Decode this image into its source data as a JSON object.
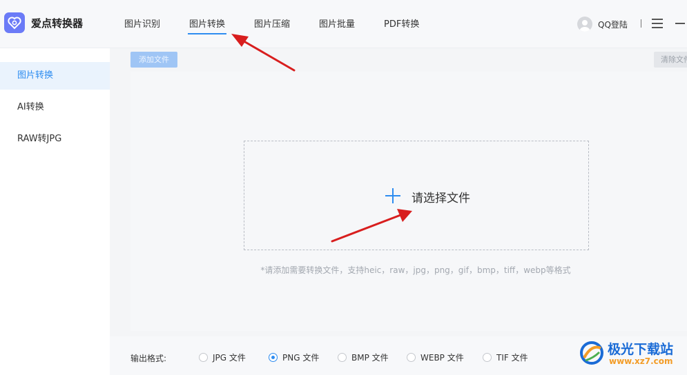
{
  "app": {
    "name": "爱点转换器"
  },
  "nav": {
    "tabs": [
      {
        "label": "图片识别"
      },
      {
        "label": "图片转换"
      },
      {
        "label": "图片压缩"
      },
      {
        "label": "图片批量"
      },
      {
        "label": "PDF转换"
      }
    ],
    "active_tab": "图片转换",
    "login_label": "QQ登陆"
  },
  "sidebar": {
    "items": [
      {
        "label": "图片转换"
      },
      {
        "label": "AI转换"
      },
      {
        "label": "RAW转JPG"
      }
    ],
    "active_item": "图片转换"
  },
  "toolbar": {
    "add_file_label": "添加文件",
    "clear_file_label": "清除文件"
  },
  "drop_zone": {
    "prompt": "请选择文件",
    "hint": "*请添加需要转换文件，支持heic，raw，jpg，png，gif，bmp，tiff，webp等格式"
  },
  "output_format": {
    "label": "输出格式:",
    "options": [
      {
        "label": "JPG 文件",
        "checked": false
      },
      {
        "label": "PNG 文件",
        "checked": true
      },
      {
        "label": "BMP 文件",
        "checked": false
      },
      {
        "label": "WEBP 文件",
        "checked": false
      },
      {
        "label": "TIF 文件",
        "checked": false
      }
    ]
  },
  "watermark": {
    "title": "极光下载站",
    "url": "www.xz7.com"
  },
  "colors": {
    "accent": "#2d8cf0",
    "logo": "#6b7bf7",
    "annotation_arrow": "#d81e1e"
  }
}
